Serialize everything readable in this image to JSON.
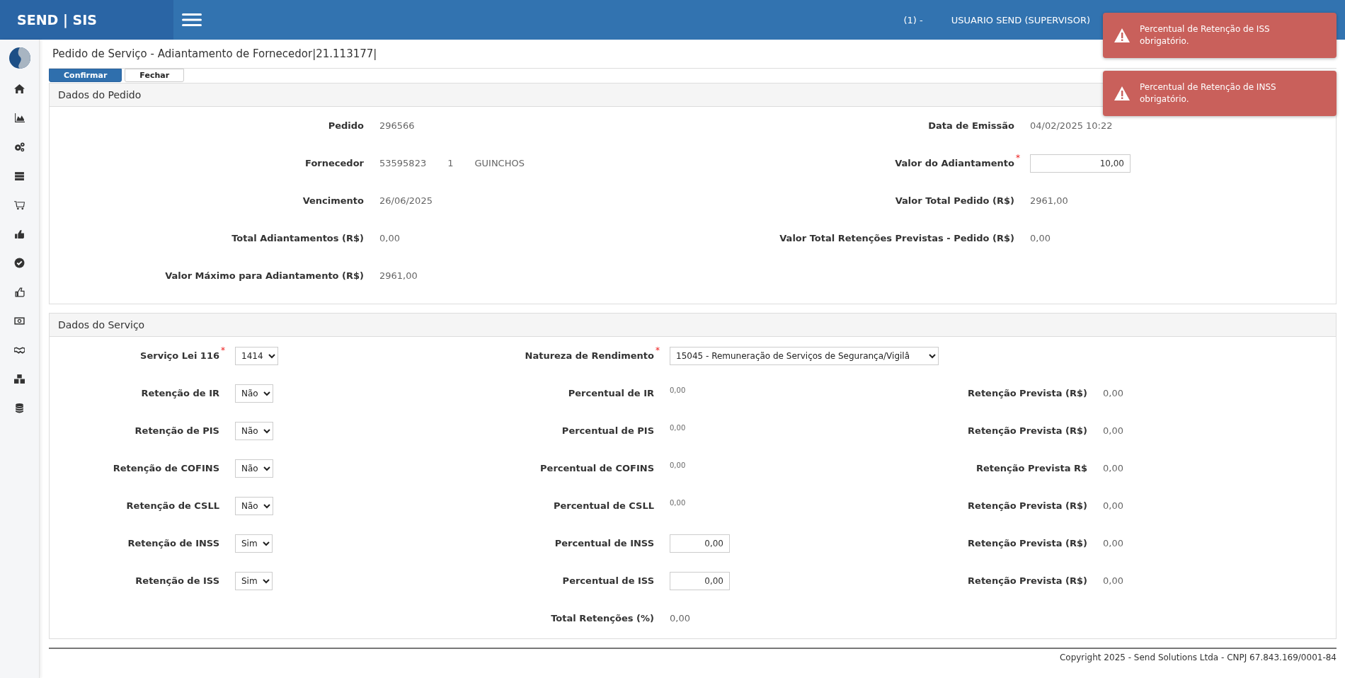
{
  "header": {
    "brand": "SEND | SIS",
    "company": "(1) -",
    "user": "USUARIO SEND (SUPERVISOR)"
  },
  "page": {
    "title": "Pedido de Serviço - Adiantamento de Fornecedor|21.113177|"
  },
  "buttons": [
    {
      "label": "Confirmar",
      "kind": "primary"
    },
    {
      "label": "Fechar",
      "kind": "default"
    }
  ],
  "order_panel": {
    "title": "Dados do Pedido",
    "rows": [
      {
        "left": {
          "label": "Pedido",
          "kind": "value",
          "value": "296566"
        },
        "right": {
          "label": "Data de Emissão",
          "kind": "value",
          "value": "04/02/2025 10:22"
        }
      },
      {
        "left": {
          "label": "Fornecedor",
          "kind": "parts",
          "parts": [
            "53595823",
            "1",
            "GUINCHOS"
          ]
        },
        "right": {
          "label": "Valor do Adiantamento",
          "kind": "input",
          "value": "10,00",
          "required_mark": "*"
        }
      },
      {
        "left": {
          "label": "Vencimento",
          "kind": "value",
          "value": "26/06/2025"
        },
        "right": {
          "label": "Valor Total Pedido (R$)",
          "kind": "value",
          "value": "2961,00"
        }
      },
      {
        "left": {
          "label": "Total Adiantamentos (R$)",
          "kind": "value",
          "value": "0,00"
        },
        "right": {
          "label": "Valor Total Retenções Previstas - Pedido (R$)",
          "kind": "value",
          "value": "0,00"
        }
      },
      {
        "left": {
          "label": "Valor Máximo para Adiantamento (R$)",
          "kind": "value",
          "value": "2961,00"
        }
      }
    ]
  },
  "service_panel": {
    "title": "Dados do Serviço",
    "rows": [
      {
        "left": {
          "label": "Serviço Lei 116",
          "kind": "select",
          "value": "1414",
          "required_mark": "*"
        },
        "middle": {
          "label": "Natureza de Rendimento",
          "kind": "select",
          "value": "15045 - Remuneração de Serviços de Segurança/Vigilâ",
          "required_mark": "*"
        }
      },
      {
        "left": {
          "label": "Retenção de IR",
          "kind": "select",
          "value": "Não"
        },
        "middle": {
          "label": "Percentual de IR",
          "kind": "note",
          "value": "0,00"
        },
        "right": {
          "label": "Retenção Prevista (R$)",
          "kind": "value",
          "value": "0,00"
        }
      },
      {
        "left": {
          "label": "Retenção de PIS",
          "kind": "select",
          "value": "Não"
        },
        "middle": {
          "label": "Percentual de PIS",
          "kind": "note",
          "value": "0,00"
        },
        "right": {
          "label": "Retenção Prevista (R$)",
          "kind": "value",
          "value": "0,00"
        }
      },
      {
        "left": {
          "label": "Retenção de COFINS",
          "kind": "select",
          "value": "Não"
        },
        "middle": {
          "label": "Percentual de COFINS",
          "kind": "note",
          "value": "0,00"
        },
        "right": {
          "label": "Retenção Prevista R$",
          "kind": "value",
          "value": "0,00"
        }
      },
      {
        "left": {
          "label": "Retenção de CSLL",
          "kind": "select",
          "value": "Não"
        },
        "middle": {
          "label": "Percentual de CSLL",
          "kind": "note",
          "value": "0,00"
        },
        "right": {
          "label": "Retenção Prevista (R$)",
          "kind": "value",
          "value": "0,00"
        }
      },
      {
        "left": {
          "label": "Retenção de INSS",
          "kind": "select",
          "value": "Sim"
        },
        "middle": {
          "label": "Percentual de INSS",
          "kind": "input",
          "value": "0,00"
        },
        "right": {
          "label": "Retenção Prevista (R$)",
          "kind": "value",
          "value": "0,00"
        }
      },
      {
        "left": {
          "label": "Retenção de ISS",
          "kind": "select",
          "value": "Sim"
        },
        "middle": {
          "label": "Percentual de ISS",
          "kind": "input",
          "value": "0,00"
        },
        "right": {
          "label": "Retenção Prevista (R$)",
          "kind": "value",
          "value": "0,00"
        }
      },
      {
        "middle": {
          "label": "Total Retenções (%)",
          "kind": "value",
          "value": "0,00"
        }
      }
    ]
  },
  "toasts": [
    {
      "message": "Percentual de Retenção de ISS obrigatório."
    },
    {
      "message": "Percentual de Retenção de INSS obrigatório."
    }
  ],
  "footer": {
    "copyright": "Copyright 2025 - Send Solutions Ltda - CNPJ 67.843.169/0001-84"
  }
}
